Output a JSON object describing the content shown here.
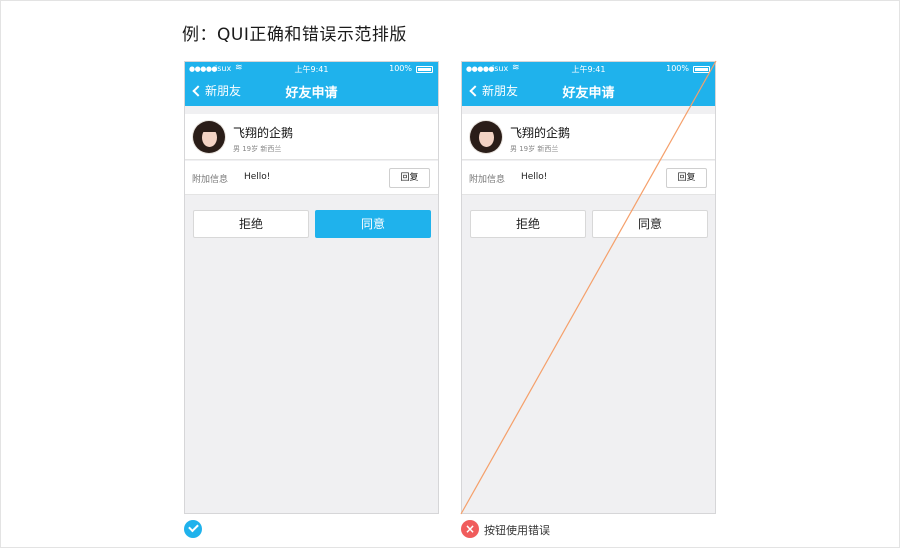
{
  "title": "例：QUI正确和错误示范排版",
  "phones": [
    {
      "status": {
        "carrier": "isux",
        "time": "上午9:41",
        "battery": "100%"
      },
      "nav": {
        "back": "新朋友",
        "title": "好友申请"
      },
      "user": {
        "name": "飞翔的企鹅",
        "meta": "男 19岁  新西兰"
      },
      "info": {
        "label": "附加信息",
        "message": "Hello!",
        "reply": "回复"
      },
      "buttons": {
        "reject": "拒绝",
        "agree": "同意"
      }
    },
    {
      "status": {
        "carrier": "isux",
        "time": "上午9:41",
        "battery": "100%"
      },
      "nav": {
        "back": "新朋友",
        "title": "好友申请"
      },
      "user": {
        "name": "飞翔的企鹅",
        "meta": "男 19岁  新西兰"
      },
      "info": {
        "label": "附加信息",
        "message": "Hello!",
        "reply": "回复"
      },
      "buttons": {
        "reject": "拒绝",
        "agree": "同意"
      }
    }
  ],
  "captions": {
    "error": "按钮使用错误"
  },
  "colors": {
    "accent": "#1fb2ec",
    "error": "#f05c5c",
    "diagonal": "#f5a06b"
  },
  "icons": {
    "ok": "check-circle-icon",
    "error": "close-circle-icon"
  }
}
